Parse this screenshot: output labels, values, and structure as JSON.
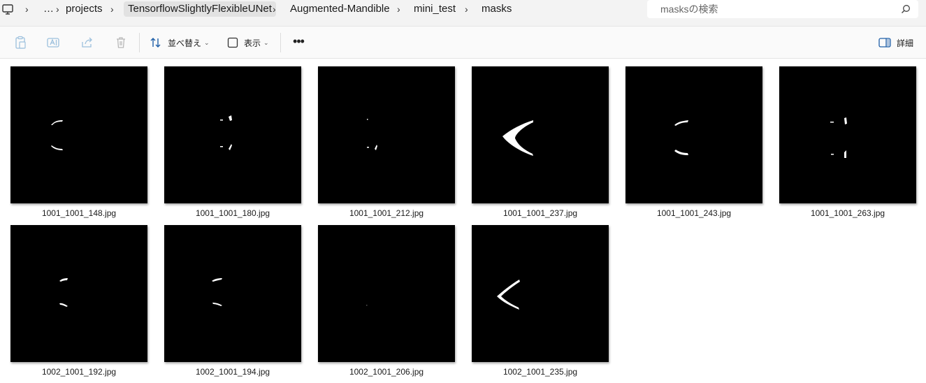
{
  "address": {
    "crumbs": [
      "…",
      "projects",
      "TensorflowSlightlyFlexibleUNet",
      "Augmented-Mandible",
      "mini_test",
      "masks"
    ],
    "search_placeholder": "masksの検索"
  },
  "toolbar": {
    "sort_label": "並べ替え",
    "view_label": "表示",
    "more_label": "•••",
    "details_label": "詳細"
  },
  "files": [
    {
      "name": "1001_1001_148.jpg"
    },
    {
      "name": "1001_1001_180.jpg"
    },
    {
      "name": "1001_1001_212.jpg"
    },
    {
      "name": "1001_1001_237.jpg"
    },
    {
      "name": "1001_1001_243.jpg"
    },
    {
      "name": "1001_1001_263.jpg"
    },
    {
      "name": "1002_1001_192.jpg"
    },
    {
      "name": "1002_1001_194.jpg"
    },
    {
      "name": "1002_1001_206.jpg"
    },
    {
      "name": "1002_1001_235.jpg"
    }
  ]
}
